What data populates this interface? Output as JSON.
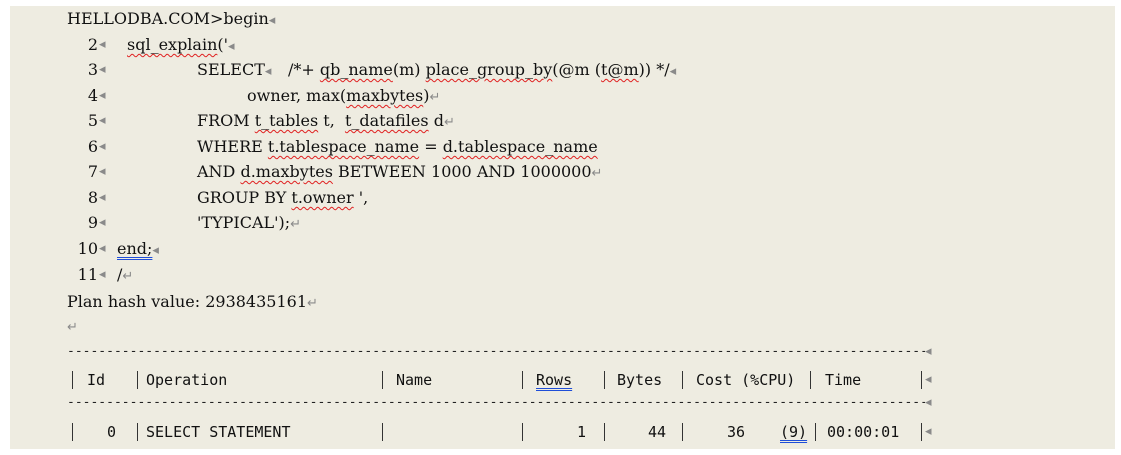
{
  "code": {
    "prompt_line": "HELLODBA.COM>begin",
    "line_numbers": [
      "2",
      "3",
      "4",
      "5",
      "6",
      "7",
      "8",
      "9",
      "10",
      "11"
    ],
    "line2_fn": "sql_explain",
    "line2_rest": "('",
    "line3_kw": "SELECT",
    "line3_hint_open": "/*+ ",
    "line3_qb": "qb_name",
    "line3_m": "(m) ",
    "line3_pgb": "place_group_by",
    "line3_at": "(@m (",
    "line3_tm": "t@m",
    "line3_end": ")) */",
    "line4_owner": "owner, max(",
    "line4_maxbytes": "maxbytes",
    "line4_end": ")",
    "line5_kw": "FROM ",
    "line5_ttables": "t_tables",
    "line5_mid": " t,  ",
    "line5_tdatafiles": "t_datafiles",
    "line5_end": " d",
    "line6_kw": "WHERE ",
    "line6_left": "t.tablespace_name",
    "line6_eq": " = ",
    "line6_right": "d.tablespace_name",
    "line7_kw": "AND ",
    "line7_col": "d.maxbytes",
    "line7_end": " BETWEEN 1000 AND 1000000",
    "line8_kw": "GROUP BY ",
    "line8_col": "t.owner",
    "line8_end": " ',",
    "line9": "'TYPICAL');",
    "line10": "end;",
    "line11": "/",
    "plan_hash": "Plan hash value: 2938435161"
  },
  "plan_table": {
    "headers": {
      "id": "Id",
      "operation": "Operation",
      "name": "Name",
      "rows": "Rows",
      "bytes": "Bytes",
      "cost": "Cost (%CPU)",
      "time": "Time"
    },
    "row0": {
      "id": "0",
      "operation": "SELECT STATEMENT",
      "name": "",
      "rows": "1",
      "bytes": "44",
      "cost": "36",
      "cpu": "(9)",
      "time": "00:00:01"
    }
  },
  "marks": {
    "paragraph": "↵",
    "cell_end": "◂",
    "bar": "|"
  }
}
